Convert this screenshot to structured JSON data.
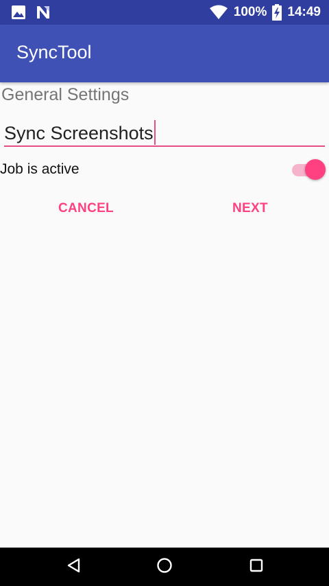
{
  "status_bar": {
    "battery": "100%",
    "time": "14:49",
    "icons": [
      "image-icon",
      "n-notification-icon",
      "wifi-icon",
      "battery-charging-icon"
    ]
  },
  "app_bar": {
    "title": "SyncTool"
  },
  "settings": {
    "section_title": "General Settings",
    "job_name_value": "Sync Screenshots",
    "active_label": "Job is active",
    "active_on": true
  },
  "actions": {
    "cancel_label": "CANCEL",
    "next_label": "NEXT"
  },
  "colors": {
    "primary_dark": "#303f9f",
    "primary": "#3f51b5",
    "accent": "#ff4081",
    "background": "#fafafa"
  },
  "nav_bar": {
    "icons": [
      "back-icon",
      "home-icon",
      "recents-icon"
    ]
  }
}
